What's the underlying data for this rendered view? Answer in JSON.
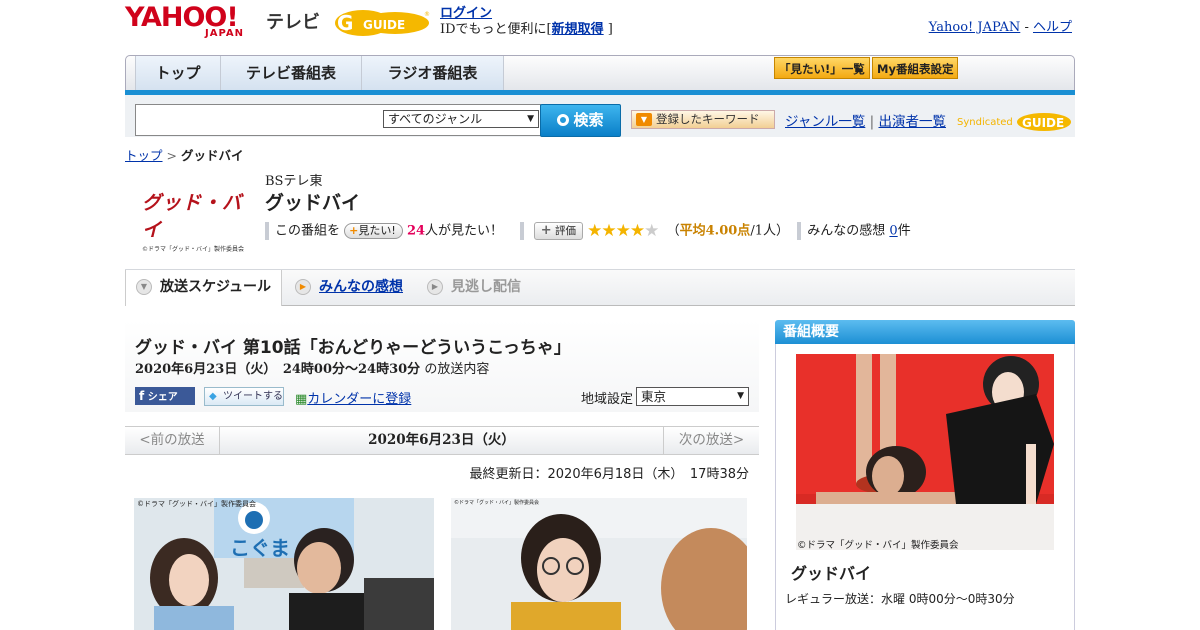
{
  "header": {
    "yahoo_logo": "YAHOO!",
    "japan_logo": "JAPAN",
    "service_name": "テレビ",
    "gguide_logo": "G-GUIDE",
    "login_link": "ログイン",
    "login_text_prefix": "IDでもっと便利に[",
    "signup_link": "新規取得",
    "login_text_suffix": "]",
    "yahoo_japan_link": "Yahoo! JAPAN",
    "link_separator": "-",
    "help_link": "ヘルプ"
  },
  "nav": {
    "tabs": [
      {
        "label": "トップ"
      },
      {
        "label": "テレビ番組表"
      },
      {
        "label": "ラジオ番組表"
      }
    ],
    "mitai_list_button": "「見たい!」一覧",
    "my_guide_button": "My番組表設定"
  },
  "search": {
    "placeholder": "",
    "genre_selected": "すべてのジャンル",
    "search_button": "検索",
    "keyword_button": "登録したキーワード",
    "genre_list_link": "ジャンル一覧",
    "divider": "|",
    "cast_list_link": "出演者一覧",
    "syndicated": "Syndicated"
  },
  "breadcrumb": {
    "home": "トップ",
    "separator": ">",
    "current": "グッドバイ"
  },
  "program": {
    "logo_text": "グッド・バイ",
    "channel": "BSテレ東",
    "title": "グッドバイ",
    "want_prefix": "この番組を",
    "want_badge": "見たい!",
    "want_count": "24",
    "want_suffix": "人が見たい！",
    "eval_badge": "評価",
    "rating": 4,
    "rating_max": 5,
    "avg_open": "（",
    "avg_label": "平均4.00点",
    "avg_people": "/1人",
    "avg_close": "）",
    "impressions_label": "みんなの感想",
    "impressions_count": "0",
    "impressions_suffix": "件"
  },
  "tabs": [
    {
      "label": "放送スケジュール"
    },
    {
      "label": "みんなの感想"
    },
    {
      "label": "見逃し配信"
    }
  ],
  "episode": {
    "title": "グッド・バイ 第10話「おんどりゃーどういうこっちゃ」",
    "date": "2020年6月23日（火）　24時00分～24時30分",
    "date_suffix": "の放送内容",
    "share_fb": "シェア",
    "share_tw": "ツイートする",
    "calendar_link": "カレンダーに登録",
    "region_label": "地域設定",
    "region_selected": "東京",
    "prev_label": "<前の放送",
    "current_date": "2020年6月23日（火）",
    "next_label": "次の放送>",
    "last_updated": "最終更新日：2020年6月18日（木）　17時38分",
    "photo1_caption": "©ドラマ「グッド・バイ」製作委員会",
    "photo1_sign": "こぐま",
    "photo2_caption": "©ドラマ「グッド・バイ」製作委員会"
  },
  "summary": {
    "heading": "番組概要",
    "copyright": "©ドラマ「グッド・バイ」製作委員会",
    "title": "グッドバイ",
    "regular": "レギュラー放送：水曜 0時00分～0時30分"
  },
  "colors": {
    "accent_blue": "#1a8fd3",
    "yahoo_red": "#d0021b",
    "star": "#f4b400",
    "pink": "#e4005b"
  }
}
